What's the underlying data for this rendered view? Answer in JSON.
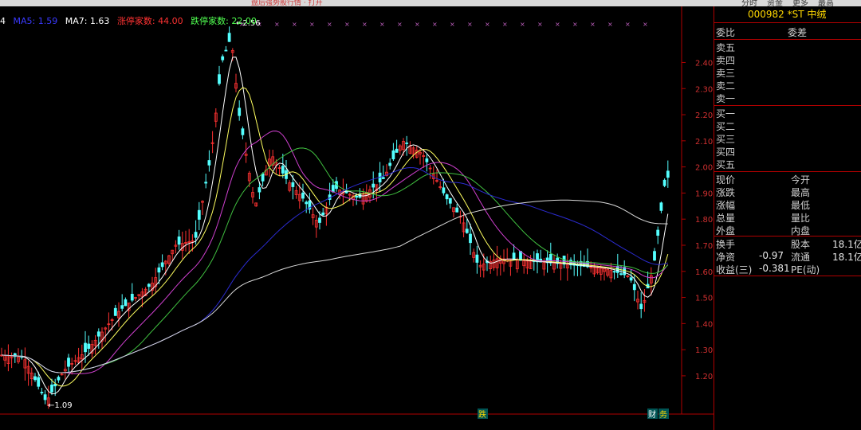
{
  "topbar": {
    "text": "盘后强势股行情 · 打开",
    "menu": [
      "分时",
      "资金",
      "更多",
      "最高"
    ]
  },
  "legend": {
    "prefix": "4",
    "ma_label": "MA5: 1.59",
    "ma7": "MA7: 1.63",
    "up_limit": "涨停家数: 44.00",
    "down_limit": "跌停家数: 22.00"
  },
  "chart": {
    "y_ticks": [
      "2.40",
      "2.30",
      "2.20",
      "2.10",
      "2.00",
      "1.90",
      "1.80",
      "1.70",
      "1.60",
      "1.50",
      "1.40",
      "1.30",
      "1.20"
    ],
    "high_label": "2.56",
    "low_label": "1.09",
    "markers": [
      "跌",
      "财",
      "务"
    ]
  },
  "panel": {
    "code_title": "000982 *ST 中绒",
    "weibi": "委比",
    "weicha": "委差",
    "sell": [
      "卖五",
      "卖四",
      "卖三",
      "卖二",
      "卖一"
    ],
    "buy": [
      "买一",
      "买二",
      "买三",
      "买四",
      "买五"
    ],
    "quote": [
      {
        "l": "现价",
        "v": "",
        "l2": "今开",
        "v2": ""
      },
      {
        "l": "涨跌",
        "v": "",
        "l2": "最高",
        "v2": ""
      },
      {
        "l": "涨幅",
        "v": "",
        "l2": "最低",
        "v2": ""
      },
      {
        "l": "总量",
        "v": "",
        "l2": "量比",
        "v2": ""
      },
      {
        "l": "外盘",
        "v": "",
        "l2": "内盘",
        "v2": ""
      }
    ],
    "fund": [
      {
        "l": "换手",
        "v": "",
        "l2": "股本",
        "v2": "18.1亿"
      },
      {
        "l": "净资",
        "v": "-0.97",
        "l2": "流通",
        "v2": "18.1亿"
      },
      {
        "l": "收益(三)",
        "v": "-0.381",
        "l2": "PE(动)",
        "v2": ""
      }
    ]
  },
  "colors": {
    "up": "#ff3232",
    "down": "#54ffff",
    "accent": "#ffd800",
    "grid": "#b00000"
  }
}
